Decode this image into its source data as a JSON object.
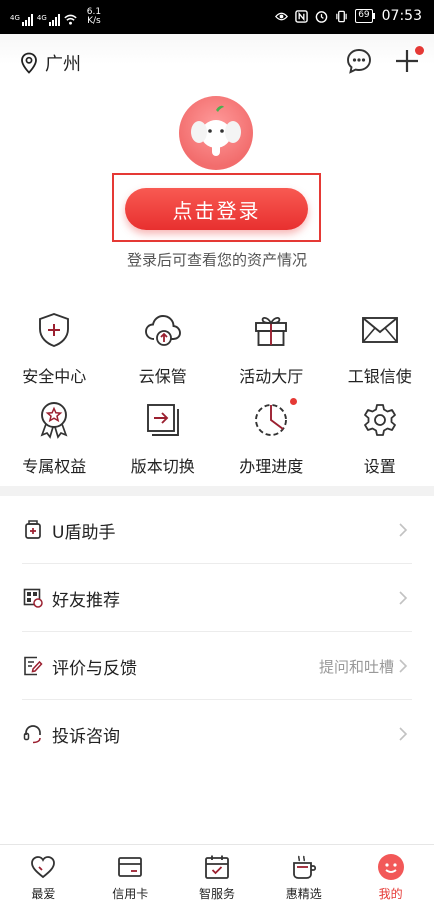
{
  "status_bar": {
    "sig1": "4G",
    "sig2": "4G",
    "speed": "6.1",
    "speed_unit": "K/s",
    "battery": "69",
    "time": "07:53"
  },
  "header": {
    "city": "广州"
  },
  "login": {
    "button": "点击登录",
    "hint": "登录后可查看您的资产情况"
  },
  "grid": {
    "row1": [
      {
        "label": "安全中心",
        "icon": "shield-plus-icon"
      },
      {
        "label": "云保管",
        "icon": "cloud-upload-icon"
      },
      {
        "label": "活动大厅",
        "icon": "gift-icon"
      },
      {
        "label": "工银信使",
        "icon": "envelope-icon"
      }
    ],
    "row2": [
      {
        "label": "专属权益",
        "icon": "medal-star-icon"
      },
      {
        "label": "版本切换",
        "icon": "switch-version-icon"
      },
      {
        "label": "办理进度",
        "icon": "progress-pie-icon"
      },
      {
        "label": "设置",
        "icon": "gear-icon"
      }
    ]
  },
  "menu": [
    {
      "label": "U盾助手",
      "extra": "",
      "icon": "usb-key-icon"
    },
    {
      "label": "好友推荐",
      "extra": "",
      "icon": "qr-recommend-icon"
    },
    {
      "label": "评价与反馈",
      "extra": "提问和吐槽",
      "icon": "feedback-edit-icon"
    },
    {
      "label": "投诉咨询",
      "extra": "",
      "icon": "headset-icon"
    }
  ],
  "tabs": [
    {
      "label": "最爱",
      "icon": "heart-icon"
    },
    {
      "label": "信用卡",
      "icon": "credit-card-icon"
    },
    {
      "label": "智服务",
      "icon": "calendar-check-icon"
    },
    {
      "label": "惠精选",
      "icon": "coffee-bag-icon"
    },
    {
      "label": "我的",
      "icon": "mine-icon",
      "active": true
    }
  ],
  "colors": {
    "accent": "#e53935",
    "icon": "#333333",
    "divider": "#f2f2f2"
  }
}
